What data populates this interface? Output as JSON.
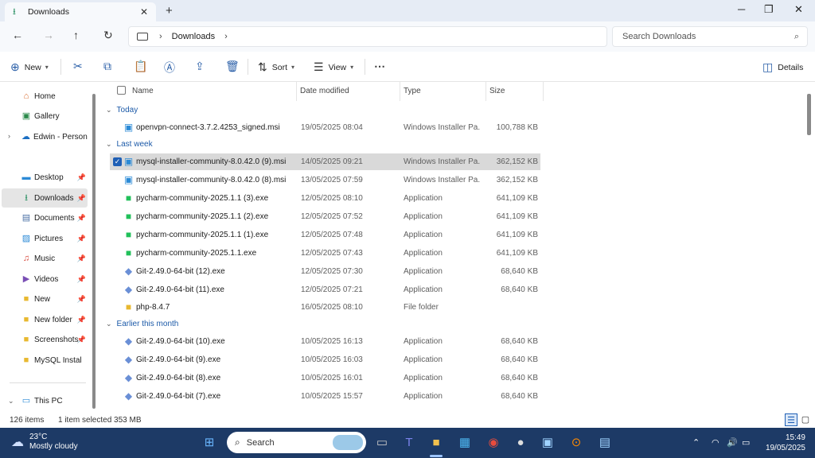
{
  "window": {
    "tab_label": "Downloads",
    "tab_icon": "download-icon"
  },
  "address": {
    "crumbs": [
      "Downloads"
    ],
    "search_placeholder": "Search Downloads"
  },
  "command_bar": {
    "new_label": "New",
    "sort_label": "Sort",
    "view_label": "View",
    "details_label": "Details"
  },
  "sidebar": {
    "items": [
      {
        "label": "Home",
        "icon": "home-icon"
      },
      {
        "label": "Gallery",
        "icon": "gallery-icon"
      },
      {
        "label": "Edwin - Personal",
        "icon": "onedrive-icon"
      },
      {
        "label": "Desktop",
        "icon": "desktop-icon"
      },
      {
        "label": "Downloads",
        "icon": "download-icon"
      },
      {
        "label": "Documents",
        "icon": "documents-icon"
      },
      {
        "label": "Pictures",
        "icon": "pictures-icon"
      },
      {
        "label": "Music",
        "icon": "music-icon"
      },
      {
        "label": "Videos",
        "icon": "videos-icon"
      },
      {
        "label": "New",
        "icon": "folder-icon"
      },
      {
        "label": "New folder",
        "icon": "folder-icon"
      },
      {
        "label": "Screenshots",
        "icon": "folder-icon"
      },
      {
        "label": "MySQL Instal",
        "icon": "folder-icon"
      },
      {
        "label": "This PC",
        "icon": "pc-icon"
      }
    ]
  },
  "columns": {
    "name": "Name",
    "date": "Date modified",
    "type": "Type",
    "size": "Size"
  },
  "groups": {
    "today": "Today",
    "last_week": "Last week",
    "earlier": "Earlier this month"
  },
  "files": [
    {
      "name": "openvpn-connect-3.7.2.4253_signed.msi",
      "date": "19/05/2025 08:04",
      "type": "Windows Installer Pa...",
      "size": "100,788 KB",
      "icon": "installer-icon"
    },
    {
      "name": "mysql-installer-community-8.0.42.0 (9).msi",
      "date": "14/05/2025 09:21",
      "type": "Windows Installer Pa...",
      "size": "362,152 KB",
      "icon": "installer-icon"
    },
    {
      "name": "mysql-installer-community-8.0.42.0 (8).msi",
      "date": "13/05/2025 07:59",
      "type": "Windows Installer Pa...",
      "size": "362,152 KB",
      "icon": "installer-icon"
    },
    {
      "name": "pycharm-community-2025.1.1 (3).exe",
      "date": "12/05/2025 08:10",
      "type": "Application",
      "size": "641,109 KB",
      "icon": "pycharm-icon"
    },
    {
      "name": "pycharm-community-2025.1.1 (2).exe",
      "date": "12/05/2025 07:52",
      "type": "Application",
      "size": "641,109 KB",
      "icon": "pycharm-icon"
    },
    {
      "name": "pycharm-community-2025.1.1 (1).exe",
      "date": "12/05/2025 07:48",
      "type": "Application",
      "size": "641,109 KB",
      "icon": "pycharm-icon"
    },
    {
      "name": "pycharm-community-2025.1.1.exe",
      "date": "12/05/2025 07:43",
      "type": "Application",
      "size": "641,109 KB",
      "icon": "pycharm-icon"
    },
    {
      "name": "Git-2.49.0-64-bit (12).exe",
      "date": "12/05/2025 07:30",
      "type": "Application",
      "size": "68,640 KB",
      "icon": "git-icon"
    },
    {
      "name": "Git-2.49.0-64-bit (11).exe",
      "date": "12/05/2025 07:21",
      "type": "Application",
      "size": "68,640 KB",
      "icon": "git-icon"
    },
    {
      "name": "php-8.4.7",
      "date": "16/05/2025 08:10",
      "type": "File folder",
      "size": "",
      "icon": "folder-icon"
    },
    {
      "name": "Git-2.49.0-64-bit (10).exe",
      "date": "10/05/2025 16:13",
      "type": "Application",
      "size": "68,640 KB",
      "icon": "git-icon"
    },
    {
      "name": "Git-2.49.0-64-bit (9).exe",
      "date": "10/05/2025 16:03",
      "type": "Application",
      "size": "68,640 KB",
      "icon": "git-icon"
    },
    {
      "name": "Git-2.49.0-64-bit (8).exe",
      "date": "10/05/2025 16:01",
      "type": "Application",
      "size": "68,640 KB",
      "icon": "git-icon"
    },
    {
      "name": "Git-2.49.0-64-bit (7).exe",
      "date": "10/05/2025 15:57",
      "type": "Application",
      "size": "68,640 KB",
      "icon": "git-icon"
    }
  ],
  "status": {
    "count": "126 items",
    "selection": "1 item selected  353 MB"
  },
  "taskbar": {
    "temperature": "23°C",
    "weather": "Mostly cloudy",
    "search_label": "Search",
    "time": "15:49",
    "date": "19/05/2025"
  },
  "colors": {
    "accent": "#1f5fb5",
    "group_header": "#1c5aa8",
    "taskbar": "#1d3a66",
    "selected_row": "#d9d9d9"
  }
}
